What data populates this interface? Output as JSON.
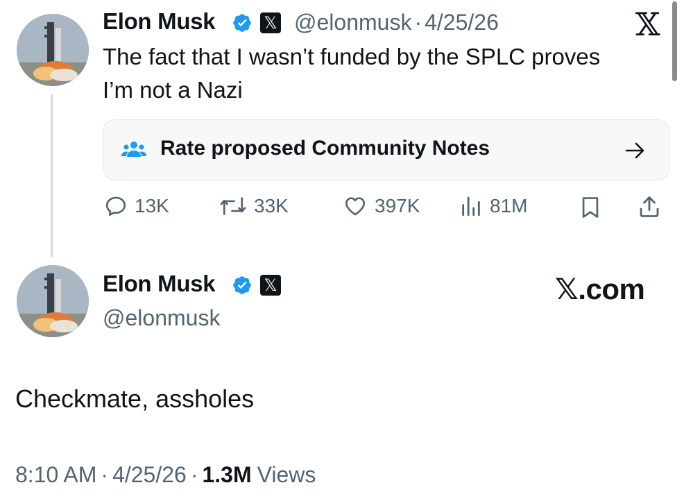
{
  "quoted_tweet": {
    "author_name": "Elon Musk",
    "handle": "@elonmusk",
    "separator": "·",
    "date": "4/25/26",
    "text_line1": "The fact that I wasn’t funded by the SPLC proves",
    "text_line2": "I’m not a Nazi",
    "community_notes_label": "Rate proposed Community Notes",
    "stats": {
      "replies": "13K",
      "reposts": "33K",
      "likes": "397K",
      "views": "81M"
    },
    "badge_icons": [
      "verified-check-icon",
      "x-logo-badge-icon"
    ],
    "close_glyph": "𝕏"
  },
  "main_tweet": {
    "author_name": "Elon Musk",
    "handle": "@elonmusk",
    "site_label": "𝕏.com",
    "text": "Checkmate, assholes",
    "time": "8:10 AM",
    "separator": "·",
    "date": "4/25/26",
    "views_count": "1.3M",
    "views_label": "Views"
  },
  "colors": {
    "text_primary": "#0f1419",
    "text_secondary": "#536471",
    "verified_blue": "#1d9bf0",
    "card_background": "#f7f9f9",
    "thread_line": "#cfd9de"
  },
  "icons": {
    "reply": "reply-icon",
    "repost": "repost-icon",
    "like": "heart-icon",
    "views": "views-chart-icon",
    "bookmark": "bookmark-icon",
    "share": "share-icon",
    "community": "people-icon",
    "arrow": "arrow-right-icon"
  }
}
